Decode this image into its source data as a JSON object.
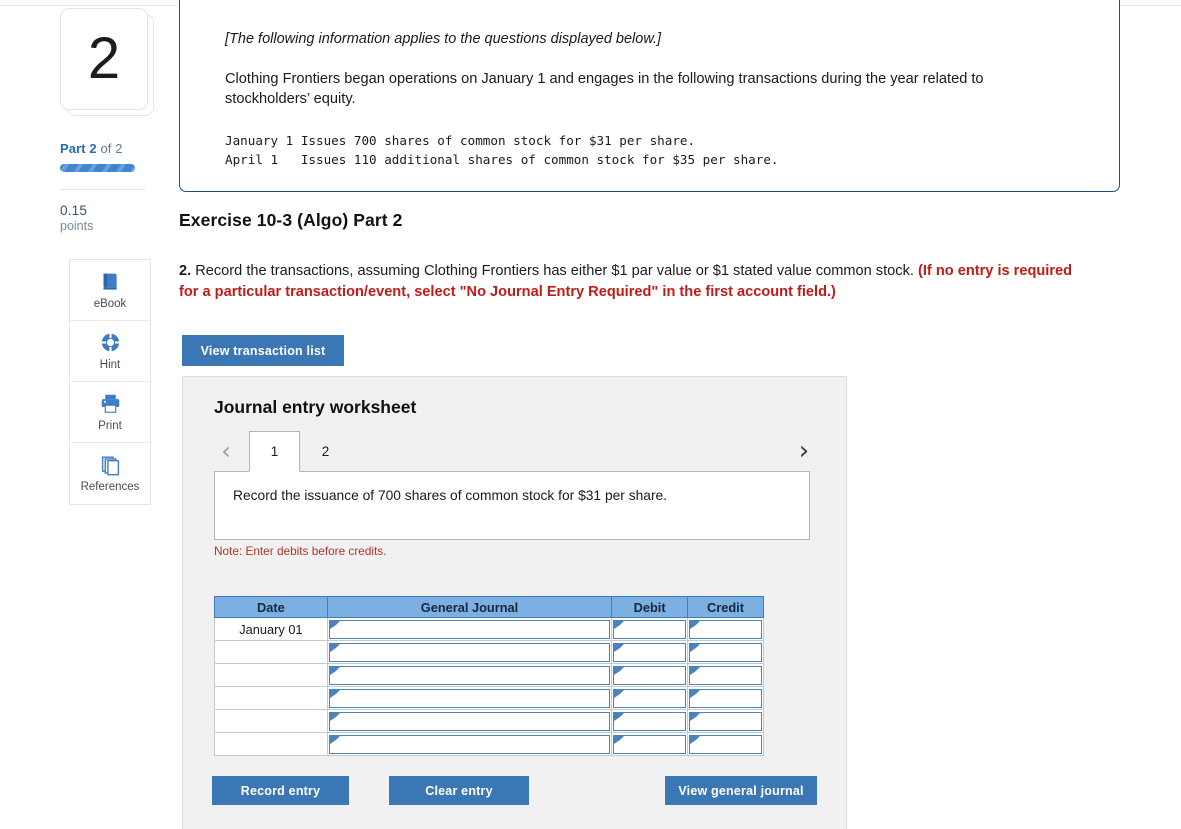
{
  "left_rail": {
    "question_number": "2",
    "part_strong": "Part 2",
    "part_rest": " of 2",
    "points_value": "0.15",
    "points_label": "points",
    "tools": [
      {
        "label": "eBook",
        "icon": "book-icon"
      },
      {
        "label": "Hint",
        "icon": "life-ring-icon"
      },
      {
        "label": "Print",
        "icon": "printer-icon"
      },
      {
        "label": "References",
        "icon": "copy-pages-icon"
      }
    ]
  },
  "info_box": {
    "italic_line": "[The following information applies to the questions displayed below.]",
    "paragraph": "Clothing Frontiers began operations on January 1 and engages in the following transactions during the year related to stockholders’ equity.",
    "transactions_mono": "January 1 Issues 700 shares of common stock for $31 per share.\nApril 1   Issues 110 additional shares of common stock for $35 per share."
  },
  "main": {
    "exercise_title": "Exercise 10-3 (Algo) Part 2",
    "question_number": "2.",
    "question_body": " Record the transactions, assuming Clothing Frontiers has either $1 par value or $1 stated value common stock. ",
    "question_warning": "(If no entry is required for a particular transaction/event, select \"No Journal Entry Required\" in the first account field.)",
    "view_transaction_list_label": "View transaction list"
  },
  "worksheet": {
    "title": "Journal entry worksheet",
    "prev_arrow": "‹",
    "next_arrow": "›",
    "tabs": [
      {
        "label": "1",
        "active": true
      },
      {
        "label": "2",
        "active": false
      }
    ],
    "description": "Record the issuance of 700 shares of common stock for $31 per share.",
    "note": "Note: Enter debits before credits.",
    "table": {
      "headers": [
        "Date",
        "General Journal",
        "Debit",
        "Credit"
      ],
      "rows": [
        {
          "date": "January 01",
          "general_journal": "",
          "debit": "",
          "credit": ""
        },
        {
          "date": "",
          "general_journal": "",
          "debit": "",
          "credit": ""
        },
        {
          "date": "",
          "general_journal": "",
          "debit": "",
          "credit": ""
        },
        {
          "date": "",
          "general_journal": "",
          "debit": "",
          "credit": ""
        },
        {
          "date": "",
          "general_journal": "",
          "debit": "",
          "credit": ""
        },
        {
          "date": "",
          "general_journal": "",
          "debit": "",
          "credit": ""
        }
      ]
    },
    "buttons": {
      "record_entry": "Record entry",
      "clear_entry": "Clear entry",
      "view_general_journal": "View general journal"
    }
  },
  "colors": {
    "accent_blue": "#3c77b5",
    "table_header_blue": "#7cafe2",
    "field_border_blue": "#4b83bd",
    "callout_border": "#1e4e8f",
    "warning_red": "#c11b17",
    "note_red": "#b0352c",
    "panel_gray": "#f1f1f1"
  }
}
